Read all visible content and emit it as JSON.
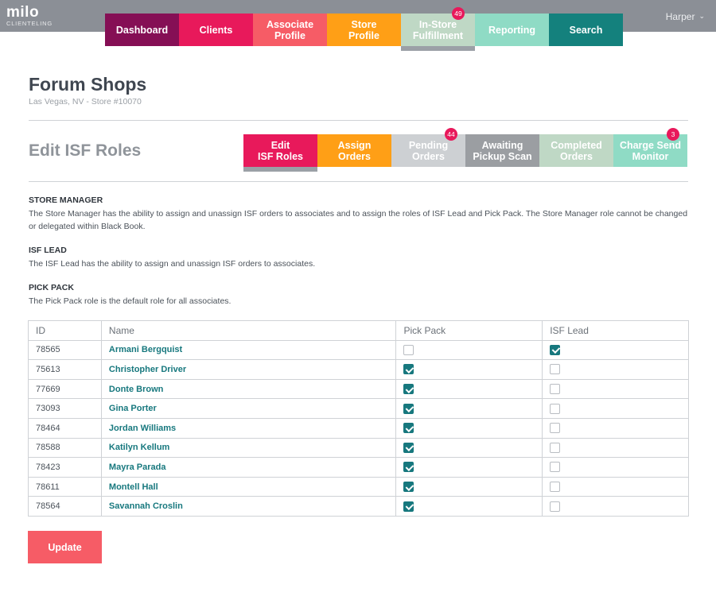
{
  "app": {
    "logo": "milo",
    "logo_sub": "CLIENTELING",
    "user": "Harper"
  },
  "nav": [
    {
      "label": "Dashboard",
      "color": "#850f55"
    },
    {
      "label": "Clients",
      "color": "#e8195b"
    },
    {
      "label": "Associate\nProfile",
      "color": "#f65c66"
    },
    {
      "label": "Store\nProfile",
      "color": "#ff9f16"
    },
    {
      "label": "In-Store\nFulfillment",
      "color": "#bfd8c5",
      "badge": "49",
      "active": true
    },
    {
      "label": "Reporting",
      "color": "#8fdbc5"
    },
    {
      "label": "Search",
      "color": "#14817d"
    }
  ],
  "store": {
    "title": "Forum Shops",
    "subtitle": "Las Vegas, NV - Store #10070"
  },
  "page_title": "Edit ISF Roles",
  "sub_tabs": [
    {
      "label": "Edit\nISF Roles",
      "color": "#e8195b",
      "active": true
    },
    {
      "label": "Assign\nOrders",
      "color": "#ff9f16"
    },
    {
      "label": "Pending\nOrders",
      "color": "#cdd0d3",
      "badge": "44"
    },
    {
      "label": "Awaiting\nPickup Scan",
      "color": "#9b9ea2"
    },
    {
      "label": "Completed\nOrders",
      "color": "#bfd8c5"
    },
    {
      "label": "Charge Send\nMonitor",
      "color": "#8fdbc5",
      "badge": "3"
    }
  ],
  "roles": [
    {
      "heading": "STORE MANAGER",
      "text": "The Store Manager has the ability to assign and unassign ISF orders to associates and to assign the roles of ISF Lead and Pick Pack. The Store Manager role cannot be changed or delegated within Black Book."
    },
    {
      "heading": "ISF LEAD",
      "text": "The ISF Lead has the ability to assign and unassign ISF orders to associates."
    },
    {
      "heading": "PICK PACK",
      "text": "The Pick Pack role is the default role for all associates."
    }
  ],
  "table": {
    "headers": [
      "ID",
      "Name",
      "Pick Pack",
      "ISF Lead"
    ],
    "rows": [
      {
        "id": "78565",
        "name": "Armani Bergquist",
        "pick_pack": false,
        "isf_lead": true
      },
      {
        "id": "75613",
        "name": "Christopher Driver",
        "pick_pack": true,
        "isf_lead": false
      },
      {
        "id": "77669",
        "name": "Donte Brown",
        "pick_pack": true,
        "isf_lead": false
      },
      {
        "id": "73093",
        "name": "Gina Porter",
        "pick_pack": true,
        "isf_lead": false
      },
      {
        "id": "78464",
        "name": "Jordan Williams",
        "pick_pack": true,
        "isf_lead": false
      },
      {
        "id": "78588",
        "name": "Katilyn Kellum",
        "pick_pack": true,
        "isf_lead": false
      },
      {
        "id": "78423",
        "name": "Mayra Parada",
        "pick_pack": true,
        "isf_lead": false
      },
      {
        "id": "78611",
        "name": "Montell Hall",
        "pick_pack": true,
        "isf_lead": false
      },
      {
        "id": "78564",
        "name": "Savannah Croslin",
        "pick_pack": true,
        "isf_lead": false
      }
    ]
  },
  "update_label": "Update"
}
